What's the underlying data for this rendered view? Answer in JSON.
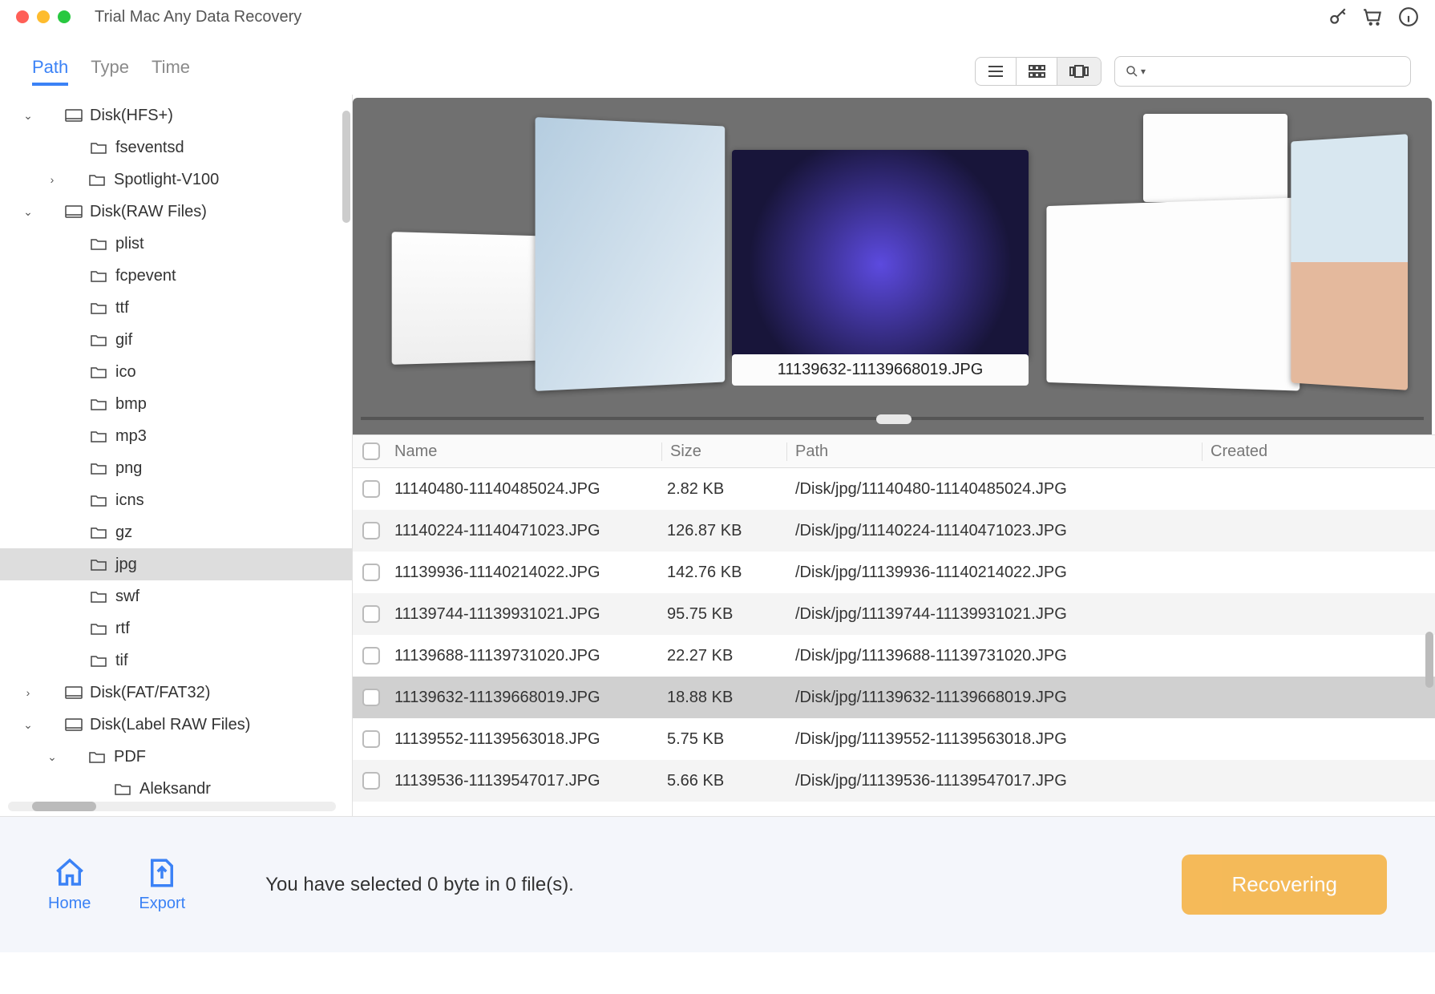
{
  "app": {
    "title": "Trial Mac Any Data Recovery"
  },
  "filters": {
    "tabs": [
      "Path",
      "Type",
      "Time"
    ],
    "active": "Path"
  },
  "search": {
    "placeholder": ""
  },
  "tree": {
    "n0": {
      "label": "Disk(HFS+)"
    },
    "n1": {
      "label": "fseventsd"
    },
    "n2": {
      "label": "Spotlight-V100"
    },
    "n3": {
      "label": "Disk(RAW Files)"
    },
    "plist": {
      "label": "plist"
    },
    "fcpevent": {
      "label": "fcpevent"
    },
    "ttf": {
      "label": "ttf"
    },
    "gif": {
      "label": "gif"
    },
    "ico": {
      "label": "ico"
    },
    "bmp": {
      "label": "bmp"
    },
    "mp3": {
      "label": "mp3"
    },
    "png": {
      "label": "png"
    },
    "icns": {
      "label": "icns"
    },
    "gz": {
      "label": "gz"
    },
    "jpg": {
      "label": "jpg"
    },
    "swf": {
      "label": "swf"
    },
    "rtf": {
      "label": "rtf"
    },
    "tif": {
      "label": "tif"
    },
    "fat": {
      "label": "Disk(FAT/FAT32)"
    },
    "labelraw": {
      "label": "Disk(Label RAW Files)"
    },
    "pdf": {
      "label": "PDF"
    },
    "aleks": {
      "label": "Aleksandr"
    }
  },
  "preview": {
    "filename": "11139632-11139668019.JPG"
  },
  "table": {
    "headers": {
      "name": "Name",
      "size": "Size",
      "path": "Path",
      "created": "Created"
    },
    "rows": [
      {
        "name": "11140480-11140485024.JPG",
        "size": "2.82 KB",
        "path": "/Disk/jpg/11140480-11140485024.JPG"
      },
      {
        "name": "11140224-11140471023.JPG",
        "size": "126.87 KB",
        "path": "/Disk/jpg/11140224-11140471023.JPG"
      },
      {
        "name": "11139936-11140214022.JPG",
        "size": "142.76 KB",
        "path": "/Disk/jpg/11139936-11140214022.JPG"
      },
      {
        "name": "11139744-11139931021.JPG",
        "size": "95.75 KB",
        "path": "/Disk/jpg/11139744-11139931021.JPG"
      },
      {
        "name": "11139688-11139731020.JPG",
        "size": "22.27 KB",
        "path": "/Disk/jpg/11139688-11139731020.JPG"
      },
      {
        "name": "11139632-11139668019.JPG",
        "size": "18.88 KB",
        "path": "/Disk/jpg/11139632-11139668019.JPG"
      },
      {
        "name": "11139552-11139563018.JPG",
        "size": "5.75 KB",
        "path": "/Disk/jpg/11139552-11139563018.JPG"
      },
      {
        "name": "11139536-11139547017.JPG",
        "size": "5.66 KB",
        "path": "/Disk/jpg/11139536-11139547017.JPG"
      }
    ],
    "selectedIndex": 5
  },
  "footer": {
    "home": "Home",
    "export": "Export",
    "status": "You have selected 0 byte in 0 file(s).",
    "recover": "Recovering"
  }
}
